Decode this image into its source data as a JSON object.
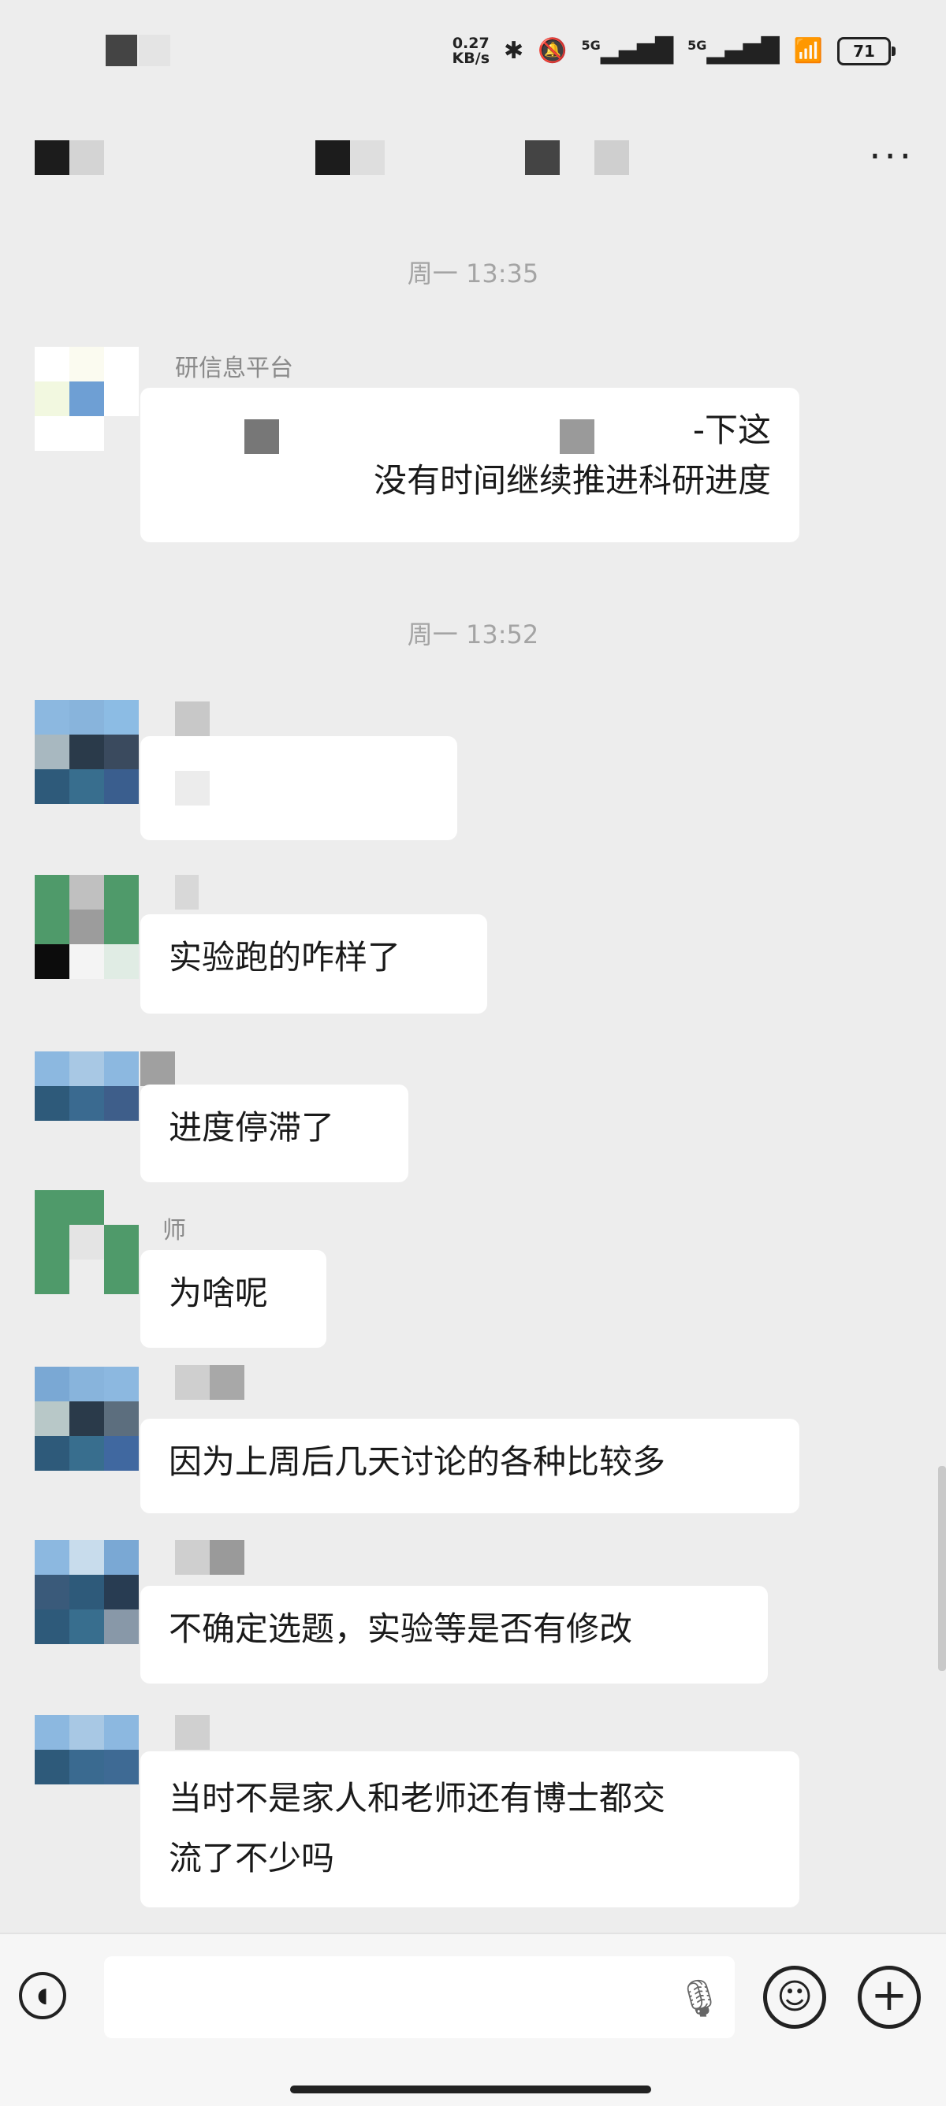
{
  "status_bar": {
    "net_speed": "0.27",
    "net_unit": "KB/s",
    "sim1": "5G",
    "sim2": "5G",
    "battery": "71",
    "icons": [
      "bluetooth-icon",
      "mute-bell-icon",
      "signal-icon",
      "wifi-icon",
      "battery-icon"
    ]
  },
  "header": {
    "more_label": "···"
  },
  "messages": [
    {
      "type": "time",
      "text": "周一 13:35"
    },
    {
      "type": "msg",
      "sender": "研信息平台",
      "lines": [
        "-下这",
        "没有时间继续推进科研进度"
      ]
    },
    {
      "type": "time",
      "text": "周一 13:52"
    },
    {
      "type": "msg",
      "sender": "",
      "lines": [
        ""
      ]
    },
    {
      "type": "msg",
      "sender": "",
      "lines": [
        "实验跑的咋样了"
      ]
    },
    {
      "type": "msg",
      "sender": "",
      "lines": [
        "进度停滞了"
      ]
    },
    {
      "type": "msg",
      "sender": "师",
      "lines": [
        "为啥呢"
      ]
    },
    {
      "type": "msg",
      "sender": "",
      "lines": [
        "因为上周后几天讨论的各种比较多"
      ]
    },
    {
      "type": "msg",
      "sender": "",
      "lines": [
        "不确定选题，实验等是否有修改"
      ]
    },
    {
      "type": "msg",
      "sender": "",
      "lines": [
        "当时不是家人和老师还有博士都交",
        "流了不少吗"
      ]
    }
  ],
  "input_bar": {
    "placeholder": ""
  },
  "colors": {
    "background": "#ededed",
    "bubble": "#ffffff",
    "timestamp": "#a4a4a4"
  }
}
